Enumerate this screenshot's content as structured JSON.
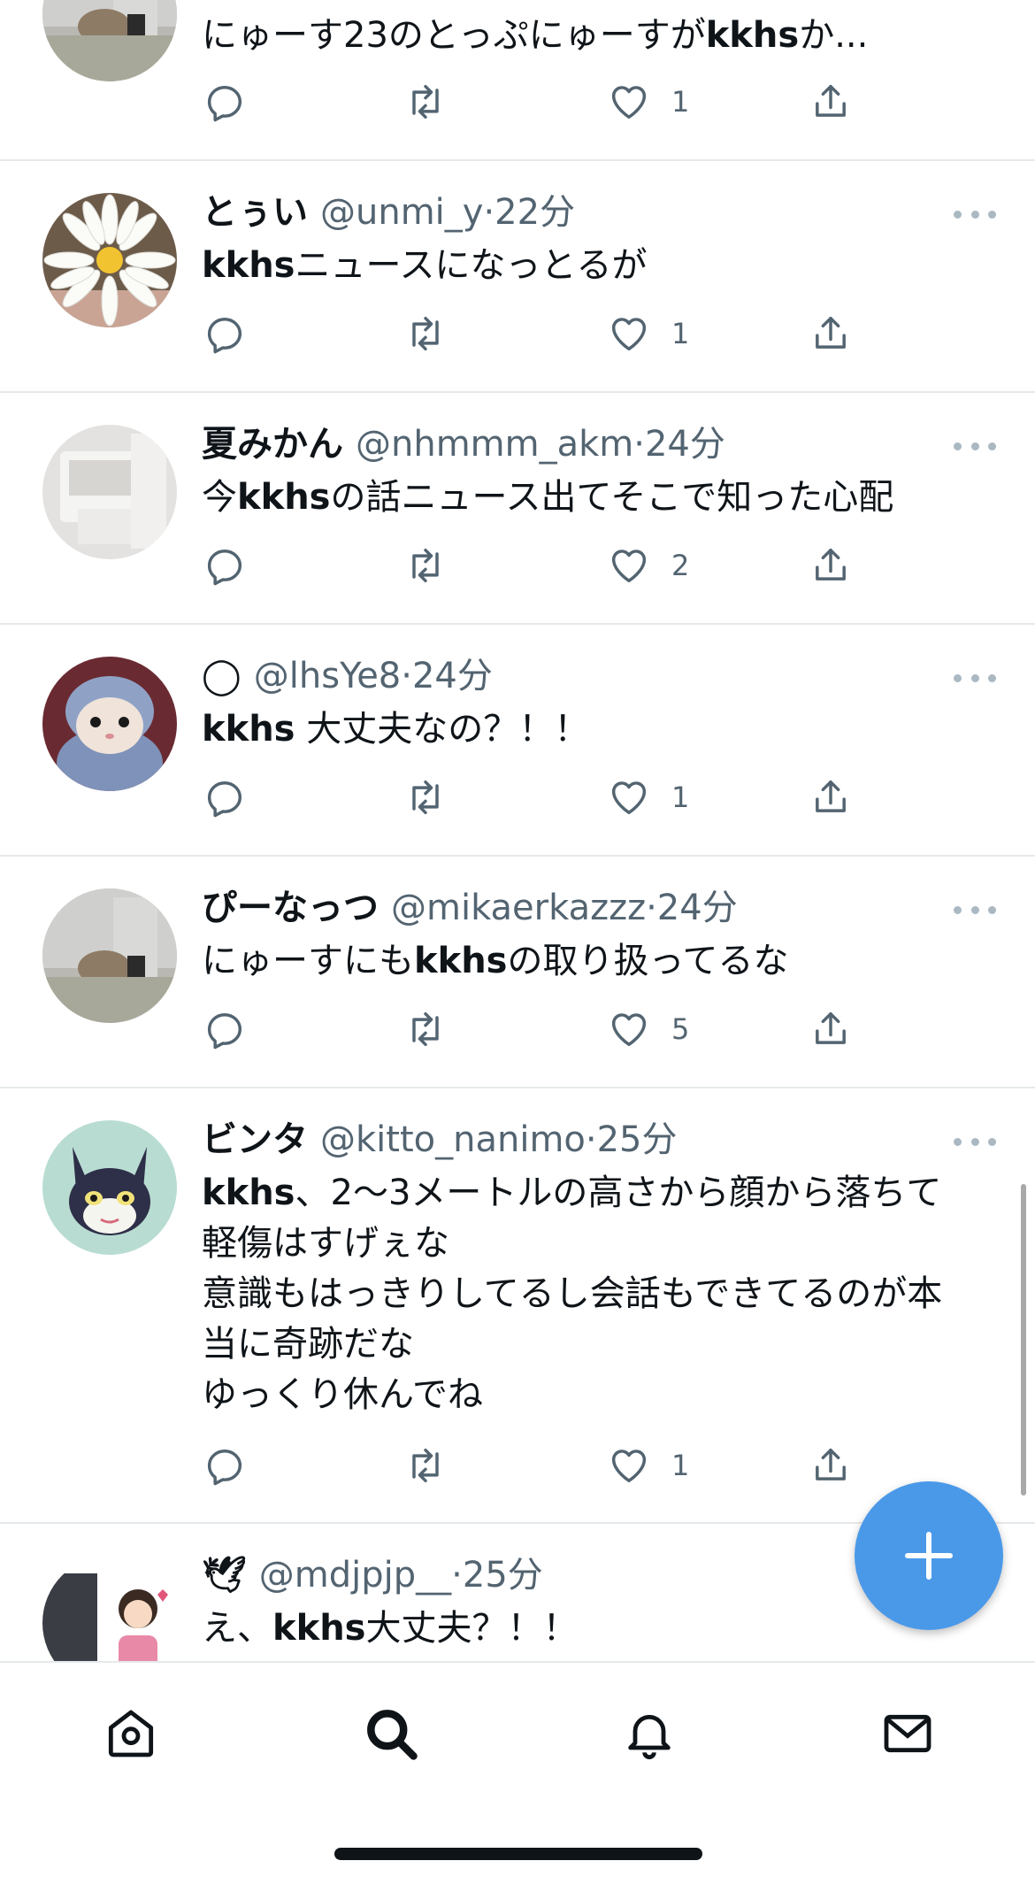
{
  "colors": {
    "accent": "#4a99e9",
    "text": "#0f1419",
    "secondary": "#536471",
    "divider": "#e6e9eb"
  },
  "tweets": [
    {
      "name": "",
      "handle": "",
      "time": "",
      "text_segments": [
        {
          "t": "にゅーす23のとっぷにゅーすが",
          "b": false
        },
        {
          "t": "kkhs",
          "b": true
        },
        {
          "t": "か...",
          "b": false
        }
      ],
      "likes": "1",
      "avatar": "photo-grey-room"
    },
    {
      "name": "とぅい",
      "handle": "@unmi_y",
      "time": "22分",
      "text_segments": [
        {
          "t": "kkhs",
          "b": true
        },
        {
          "t": "ニュースになっとるが",
          "b": false
        }
      ],
      "likes": "1",
      "avatar": "daisy-flower"
    },
    {
      "name": "夏みかん",
      "handle": "@nhmmm_akm",
      "time": "24分",
      "text_segments": [
        {
          "t": "今",
          "b": false
        },
        {
          "t": "kkhs",
          "b": true
        },
        {
          "t": "の話ニュース出てそこで知った心配",
          "b": false
        }
      ],
      "likes": "2",
      "avatar": "white-object"
    },
    {
      "name": "◯",
      "handle": "@lhsYe8",
      "time": "24分",
      "text_segments": [
        {
          "t": "kkhs",
          "b": true
        },
        {
          "t": " 大丈夫なの？！！",
          "b": false
        }
      ],
      "likes": "1",
      "avatar": "hamster"
    },
    {
      "name": "ぴーなっつ",
      "handle": "@mikaerkazzz",
      "time": "24分",
      "text_segments": [
        {
          "t": "にゅーすにも",
          "b": false
        },
        {
          "t": "kkhs",
          "b": true
        },
        {
          "t": "の取り扱ってるな",
          "b": false
        }
      ],
      "likes": "5",
      "avatar": "photo-grey-room"
    },
    {
      "name": "ビンタ",
      "handle": "@kitto_nanimo",
      "time": "25分",
      "lines": [
        [
          {
            "t": "kkhs",
            "b": true
          },
          {
            "t": "、2〜3メートルの高さから顔から落ちて",
            "b": false
          }
        ],
        [
          {
            "t": "軽傷はすげぇな",
            "b": false
          }
        ],
        [
          {
            "t": "意識もはっきりしてるし会話もできてるのが本",
            "b": false
          }
        ],
        [
          {
            "t": "当に奇跡だな",
            "b": false
          }
        ],
        [
          {
            "t": "ゆっくり休んでね",
            "b": false
          }
        ]
      ],
      "likes": "1",
      "avatar": "cat-character"
    },
    {
      "name": "🕊",
      "handle": "@mdjpjp__",
      "time": "25分",
      "text_segments": [
        {
          "t": "え、",
          "b": false
        },
        {
          "t": "kkhs",
          "b": true
        },
        {
          "t": "大丈夫？！！",
          "b": false
        }
      ],
      "avatar": "illustration-girl"
    }
  ],
  "sep": "·",
  "fab_icon": "plus-icon",
  "tabbar": [
    "home-icon",
    "search-icon",
    "bell-icon",
    "mail-icon"
  ]
}
